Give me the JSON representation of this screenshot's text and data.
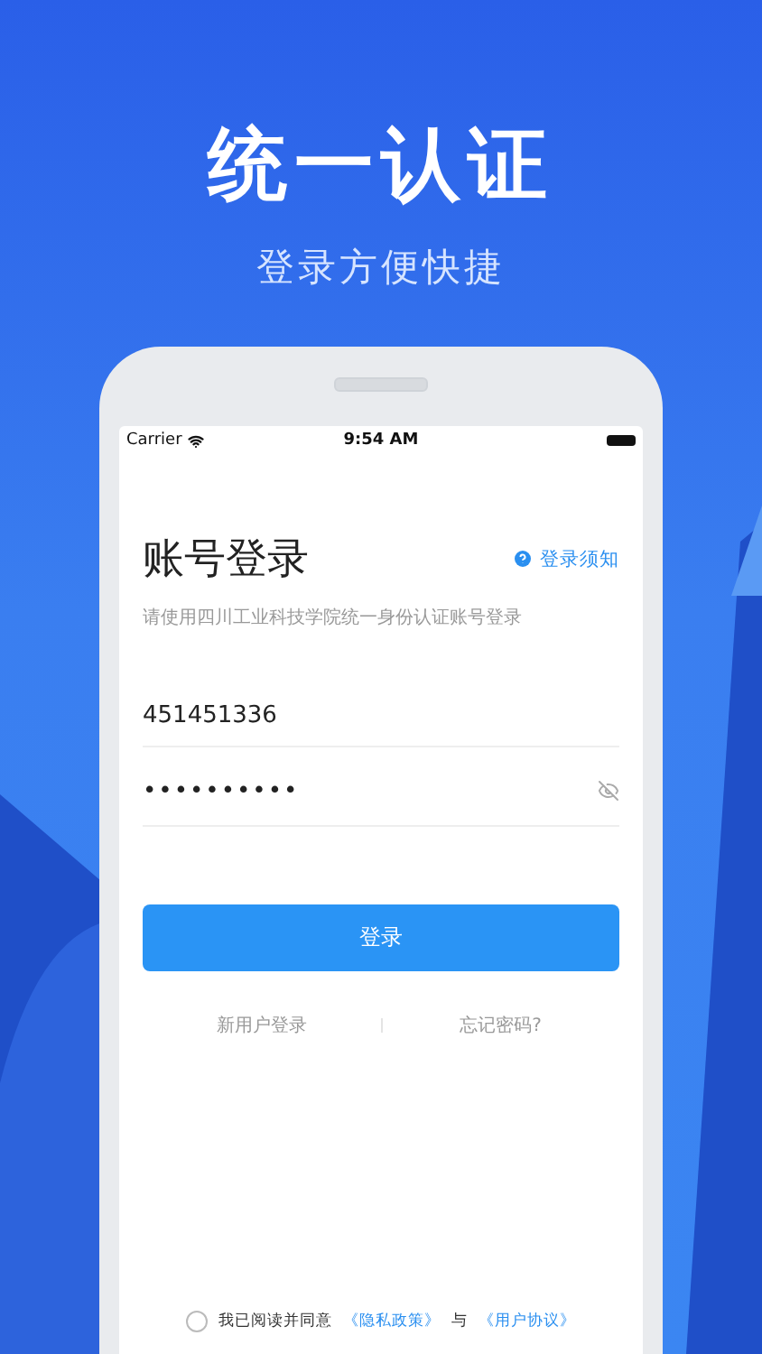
{
  "hero": {
    "title": "统一认证",
    "subtitle": "登录方便快捷"
  },
  "status_bar": {
    "carrier": "Carrier",
    "time": "9:54 AM"
  },
  "login": {
    "title": "账号登录",
    "help_link": "登录须知",
    "description": "请使用四川工业科技学院统一身份认证账号登录",
    "username": {
      "value": "451451336"
    },
    "password": {
      "value": "••••••••••",
      "visible": false
    },
    "submit": "登录",
    "links": [
      "新用户登录",
      "忘记密码?"
    ]
  },
  "agreement": {
    "checked": false,
    "text": "我已阅读并同意",
    "privacy_link": "《隐私政策》",
    "joiner": "与",
    "terms_link": "《用户协议》"
  }
}
